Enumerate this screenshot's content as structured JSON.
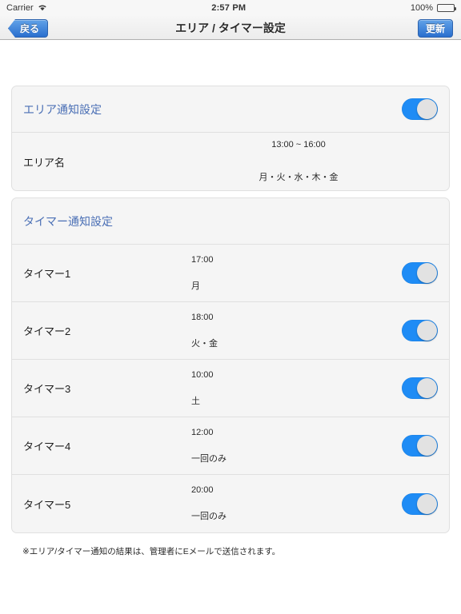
{
  "status_bar": {
    "carrier": "Carrier",
    "wifi_icon": "wifi-icon",
    "time": "2:57 PM",
    "battery_percent": "100%",
    "battery_icon": "battery-full-icon"
  },
  "nav_bar": {
    "back_label": "戻る",
    "title": "エリア / タイマー設定",
    "update_label": "更新"
  },
  "area_section": {
    "header_title": "エリア通知設定",
    "header_toggle_state": "on",
    "row": {
      "label": "エリア名",
      "time": "13:00 ~ 16:00",
      "days": "月・火・水・木・金"
    }
  },
  "timer_section": {
    "header_title": "タイマー通知設定",
    "timers": [
      {
        "label": "タイマー1",
        "time": "17:00",
        "days": "月",
        "toggle_state": "on"
      },
      {
        "label": "タイマー2",
        "time": "18:00",
        "days": "火・金",
        "toggle_state": "on"
      },
      {
        "label": "タイマー3",
        "time": "10:00",
        "days": "土",
        "toggle_state": "on"
      },
      {
        "label": "タイマー4",
        "time": "12:00",
        "days": "一回のみ",
        "toggle_state": "on"
      },
      {
        "label": "タイマー5",
        "time": "20:00",
        "days": "一回のみ",
        "toggle_state": "on"
      }
    ]
  },
  "footer": {
    "note": "※エリア/タイマー通知の結果は、管理者にEメールで送信されます。"
  },
  "colors": {
    "accent_blue": "#1f8cf5",
    "section_title_blue": "#4a6fb5",
    "card_bg": "#f5f5f5",
    "page_bg": "#ffffff",
    "separator": "#e0e0e0"
  }
}
